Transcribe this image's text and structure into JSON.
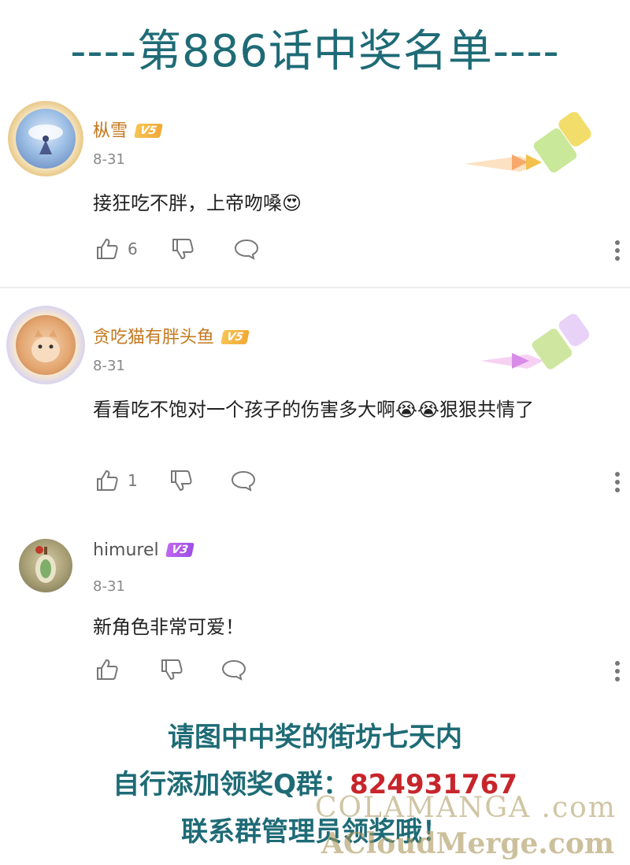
{
  "title": "----第886话中奖名单----",
  "comments": [
    {
      "username": "枞雪",
      "badge": "V5",
      "date": "8-31",
      "text": "接狂吃不胖，上帝吻嗓😍",
      "likes": "6"
    },
    {
      "username": "贪吃猫有胖头鱼",
      "badge": "V5",
      "date": "8-31",
      "text": "看看吃不饱对一个孩子的伤害多大啊😭😭狠狠共情了",
      "likes": "1"
    },
    {
      "username": "himurel",
      "badge": "V3",
      "date": "8-31",
      "text": "新角色非常可爱！",
      "likes": ""
    }
  ],
  "footer": {
    "line1": "请图中中奖的街坊七天内",
    "line2_prefix": "自行添加领奖Q群：",
    "qq_number": "824931767",
    "line3": "联系群管理员领奖哦！"
  },
  "watermark": {
    "line1": "COLAMANGA .com",
    "line2": "ACloudMerge.com"
  },
  "colors": {
    "title": "#1e6b76",
    "username_vip": "#c4781e",
    "qq_number": "#c7252b",
    "badge_v5": "#f2a936",
    "badge_v3": "#a855e8"
  },
  "icons": [
    "thumbs-up-icon",
    "thumbs-down-icon",
    "reply-icon",
    "more-icon"
  ]
}
